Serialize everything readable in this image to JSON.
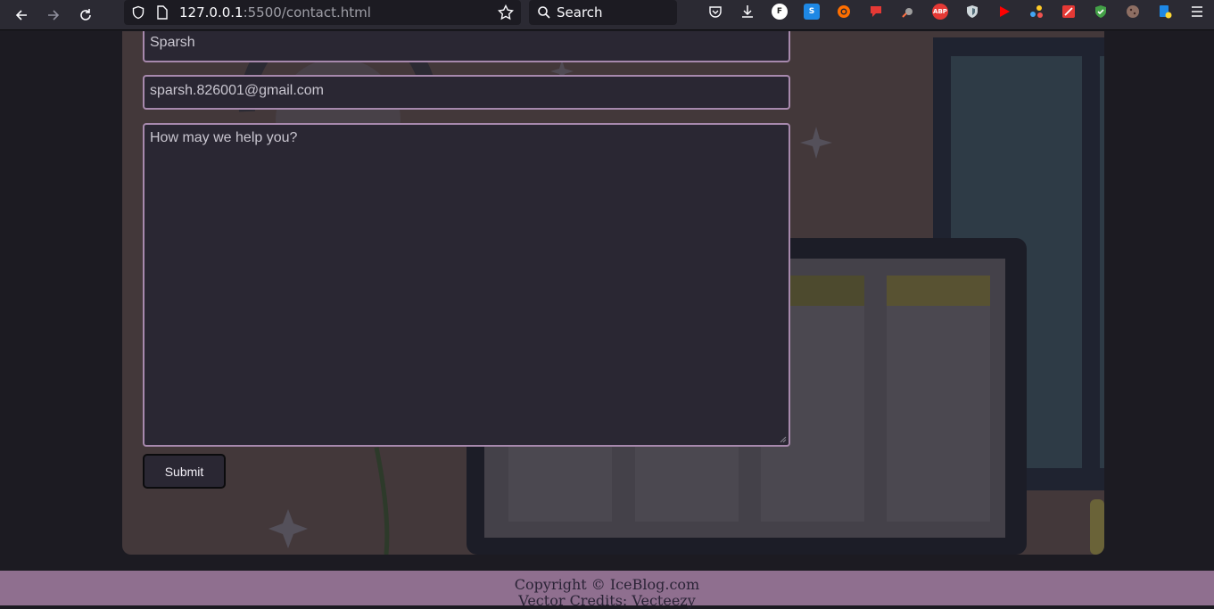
{
  "browser": {
    "url_host": "127.0.0.1",
    "url_path": ":5500/contact.html",
    "search_placeholder": "Search",
    "extensions": [
      {
        "name": "pocket-icon",
        "label": ""
      },
      {
        "name": "download-icon",
        "label": ""
      },
      {
        "name": "ext-f-icon",
        "label": "F",
        "color": "#ffffff"
      },
      {
        "name": "ext-s-icon",
        "label": "S",
        "color": "#1e88e5"
      },
      {
        "name": "ext-orange-icon",
        "label": "",
        "color": "#ff6f00"
      },
      {
        "name": "ext-red-flag-icon",
        "label": "",
        "color": "#e53935"
      },
      {
        "name": "ext-rocket-icon",
        "label": "",
        "color": "#e0e0e0"
      },
      {
        "name": "adblock-icon",
        "label": "ABP",
        "color": "#e53935"
      },
      {
        "name": "shield-ext-icon",
        "label": "",
        "color": "#cfd8dc"
      },
      {
        "name": "youtube-icon",
        "label": "",
        "color": "#ff0000"
      },
      {
        "name": "dots-ext-icon",
        "label": "",
        "color": "#42a5f5"
      },
      {
        "name": "ext-wand-icon",
        "label": "",
        "color": "#e53935"
      },
      {
        "name": "green-shield-icon",
        "label": "",
        "color": "#43a047"
      },
      {
        "name": "cookie-icon",
        "label": "",
        "color": "#8d6e63"
      },
      {
        "name": "ext-doc-icon",
        "label": "",
        "color": "#1e88e5"
      }
    ]
  },
  "form": {
    "name_value": "Sparsh",
    "email_value": "sparsh.826001@gmail.com",
    "message_placeholder": "How may we help you?",
    "submit_label": "Submit"
  },
  "footer": {
    "copyright": "Copyright © IceBlog.com",
    "credits": "Vector Credits: Vecteezy"
  },
  "colors": {
    "field_border": "#a789ad",
    "field_bg": "#2a2733",
    "footer_bg": "#8f6f8f",
    "card_bg": "#43383a"
  }
}
